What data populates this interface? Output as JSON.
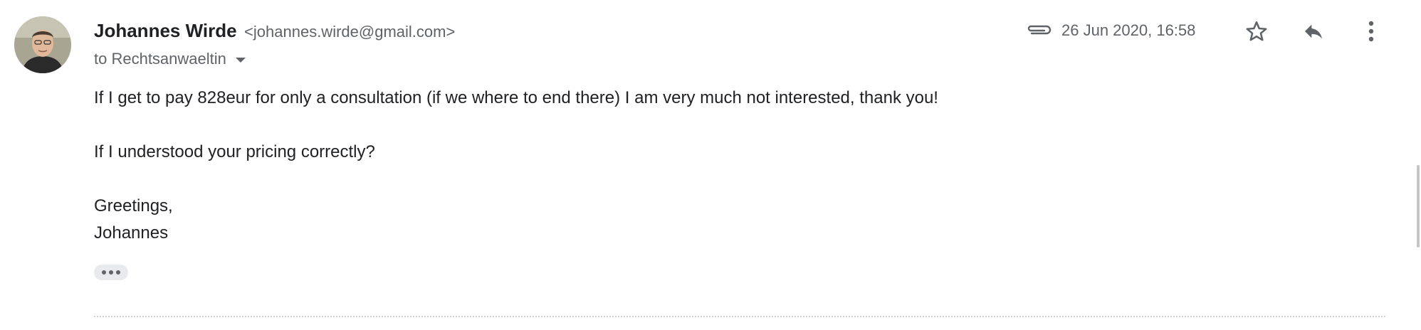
{
  "message": {
    "sender": {
      "name": "Johannes Wirde",
      "email": "<johannes.wirde@gmail.com>",
      "avatar_icon": "person-photo"
    },
    "recipient_line": "to Rechtsanwaeltin",
    "timestamp": "26 Jun 2020, 16:58",
    "has_attachment": true,
    "actions": {
      "star_icon": "star-outline-icon",
      "reply_icon": "reply-icon",
      "more_icon": "more-vert-icon"
    },
    "body": [
      "If I get to pay 828eur for only a consultation (if we where to end there) I am very much not interested, thank you!",
      "If I understood your pricing correctly?",
      "Greetings,",
      "Johannes"
    ],
    "trimmed_content_icon": "ellipsis-icon"
  },
  "colors": {
    "text_primary": "#202124",
    "text_secondary": "#5f6368",
    "chip_background": "#e8eaed"
  }
}
